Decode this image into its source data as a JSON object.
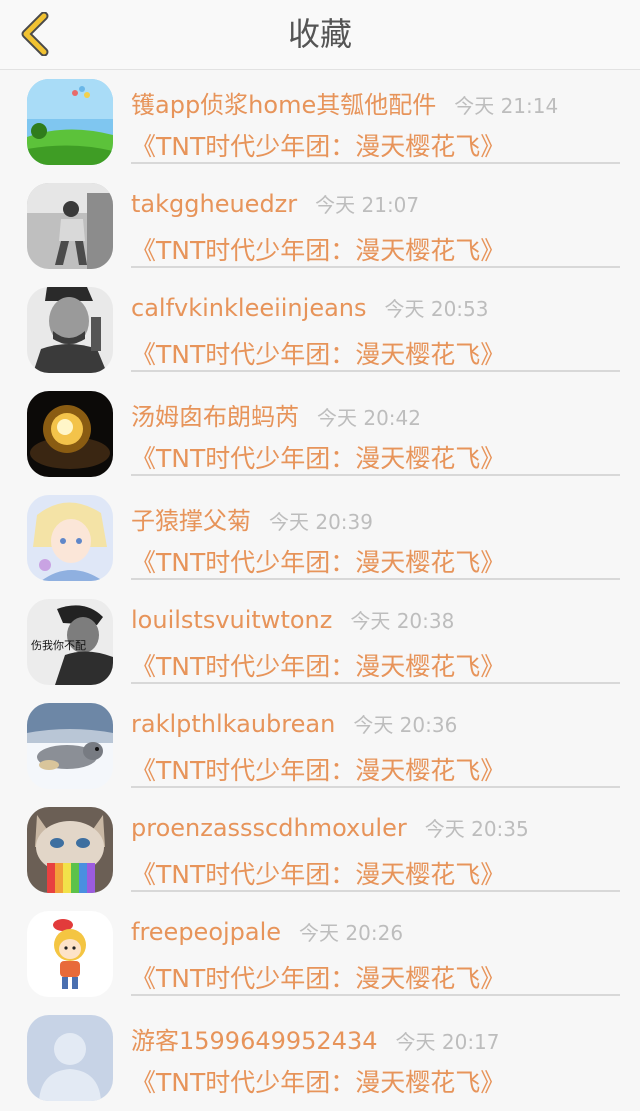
{
  "header": {
    "title": "收藏",
    "back_icon": "chevron-left-icon",
    "accent": "#f1c232"
  },
  "favorites": [
    {
      "name": "镬app侦浆home其瓠他配件",
      "time": "今天 21:14",
      "work": "《TNT时代少年团：漫天樱花飞》",
      "avatar": "landscape-avatar"
    },
    {
      "name": "takggheuedzr",
      "time": "今天 21:07",
      "work": "《TNT时代少年团：漫天樱花飞》",
      "avatar": "walking-person-avatar"
    },
    {
      "name": "calfvkinkleeiinjeans",
      "time": "今天 20:53",
      "work": "《TNT时代少年团：漫天樱花飞》",
      "avatar": "man-portrait-avatar"
    },
    {
      "name": "汤姆囱布朗蚂芮",
      "time": "今天 20:42",
      "work": "《TNT时代少年团：漫天樱花飞》",
      "avatar": "lightbulb-avatar"
    },
    {
      "name": "子猿撑父菊",
      "time": "今天 20:39",
      "work": "《TNT时代少年团：漫天樱花飞》",
      "avatar": "anime-avatar"
    },
    {
      "name": "louilstsvuitwtonz",
      "time": "今天 20:38",
      "work": "《TNT时代少年团：漫天樱花飞》",
      "avatar": "text-portrait-avatar",
      "avatar_text": "伤我你不配"
    },
    {
      "name": "raklpthlkaubrean",
      "time": "今天 20:36",
      "work": "《TNT时代少年团：漫天樱花飞》",
      "avatar": "seal-avatar"
    },
    {
      "name": "proenzassscdhmoxuler",
      "time": "今天 20:35",
      "work": "《TNT时代少年团：漫天樱花飞》",
      "avatar": "grumpy-cat-avatar"
    },
    {
      "name": "freepeojpale",
      "time": "今天 20:26",
      "work": "《TNT时代少年团：漫天樱花飞》",
      "avatar": "cartoon-girl-avatar"
    },
    {
      "name": "游客1599649952434",
      "time": "今天 20:17",
      "work": "《TNT时代少年团：漫天樱花飞》",
      "avatar": "default-user-avatar"
    }
  ]
}
